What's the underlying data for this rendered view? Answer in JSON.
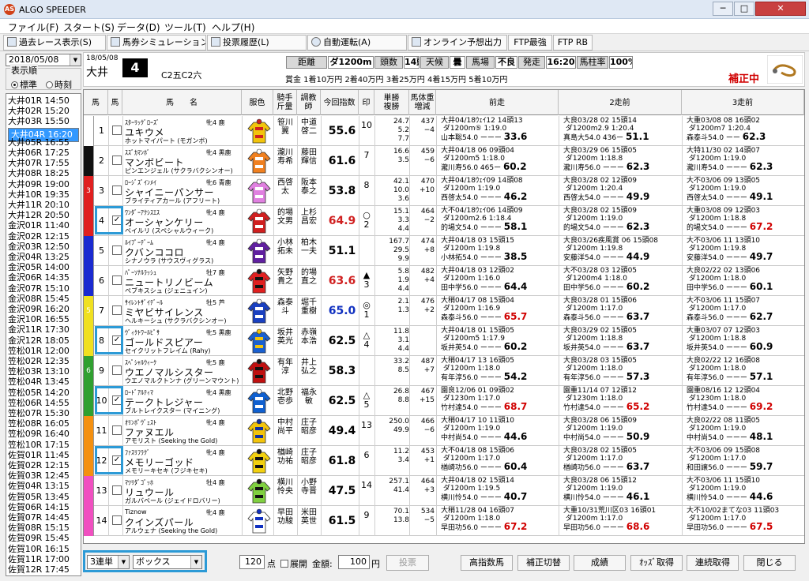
{
  "app": {
    "title": "ALGO SPEEDER",
    "icon": "AS"
  },
  "window": {
    "minimize": "─",
    "maximize": "□",
    "close": "✕"
  },
  "menu": [
    "ファイル(F)",
    "スタート(S)",
    "データ(D)",
    "ツール(T)",
    "ヘルプ(H)"
  ],
  "toolbar": [
    "過去レース表示(S)",
    "馬券シミュレーション(B)",
    "投票履歴(L)",
    "自動運転(A)",
    "オンライン予想出力",
    "FTP最強",
    "FTP RB"
  ],
  "sidebar": {
    "date": "2018/05/08",
    "order_label": "表示順",
    "order_opts": [
      "標準",
      "時刻"
    ],
    "races": [
      "大井01R 14:50",
      "大井02R 15:20",
      "大井03R 15:50",
      "大井04R 16:20",
      "大井05R 16:55",
      "大井06R 17:25",
      "大井07R 17:55",
      "大井08R 18:25",
      "大井09R 19:00",
      "大井10R 19:35",
      "大井11R 20:10",
      "大井12R 20:50",
      "金沢01R 11:40",
      "金沢02R 12:15",
      "金沢03R 12:50",
      "金沢04R 13:25",
      "金沢05R 14:00",
      "金沢06R 14:35",
      "金沢07R 15:10",
      "金沢08R 15:45",
      "金沢09R 16:20",
      "金沢10R 16:55",
      "金沢11R 17:30",
      "金沢12R 18:05",
      "笠松01R 12:00",
      "笠松02R 12:35",
      "笠松03R 13:10",
      "笠松04R 13:45",
      "笠松05R 14:20",
      "笠松06R 14:55",
      "笠松07R 15:30",
      "笠松08R 16:05",
      "笠松09R 16:40",
      "笠松10R 17:15",
      "佐賀01R 11:45",
      "佐賀02R 12:15",
      "佐賀03R 12:45",
      "佐賀04R 13:15",
      "佐賀05R 13:45",
      "佐賀06R 14:15",
      "佐賀07R 14:45",
      "佐賀08R 15:15",
      "佐賀09R 15:45",
      "佐賀10R 16:15",
      "佐賀11R 17:00",
      "佐賀12R 17:45"
    ],
    "selected": 3
  },
  "race": {
    "date": "18/05/08",
    "course": "大井",
    "num": "4",
    "class": "C2五C2六",
    "info": [
      {
        "l": "距離"
      },
      {
        "v": "ダ1200m"
      },
      {
        "l": "頭数"
      },
      {
        "v": "14頭"
      },
      {
        "l": "天候"
      },
      {
        "v": "曇"
      },
      {
        "l": "馬場"
      },
      {
        "v": "不良"
      },
      {
        "l": "発走"
      },
      {
        "v": "16:20"
      },
      {
        "l": "馬柱率"
      },
      {
        "v": "100%"
      }
    ],
    "prizes": "賞金 1着10万円 2着40万円 3着25万円 4着15万円 5着10万円",
    "status": "補正中"
  },
  "headers": [
    "馬",
    "馬",
    "馬　　名",
    "服色",
    "騎手\n斤量",
    "調教\n師",
    "今回指数",
    "印",
    "単勝\n複勝",
    "馬体重\n増減",
    "前走",
    "2走前",
    "3走前"
  ],
  "frame_colors": [
    "#ffffff",
    "#111111",
    "#e02020",
    "#e02020",
    "#1a2ad0",
    "#1a2ad0",
    "#f0e020",
    "#f0e020",
    "#30a030",
    "#30a030",
    "#f49010",
    "#f49010",
    "#f050c0",
    "#f050c0"
  ],
  "frame_labels": [
    "",
    "",
    "3",
    "",
    "",
    "",
    "5",
    "",
    "6",
    "",
    "",
    "",
    "",
    ""
  ],
  "horses": [
    {
      "n": "1",
      "sire": "ｽﾀｰﾘｯｸﾞﾛｰｽﾞ",
      "sex": "牝4 鹿",
      "name": "ユキウメ",
      "dam": "ホットマイパート (モガンボ)",
      "jk": "笹川翼",
      "tr": "中道啓二",
      "idx": "55.6",
      "ic": "#000000",
      "mark": "10",
      "odds": "24.7\n5.2\n7.7",
      "wt": "437\n−4",
      "chk": false,
      "silk": [
        "#f2c40c",
        "#d02020"
      ],
      "p1": "大井04/18ｳｪｲ12 14頭13\n ダ1200m⑤ 1:19.0\n山本聡54.0 ーーー 33.6",
      "p2": "大良03/28 02 15頭14\n ダ1200m2.9 1:20.4\n真島大54.0 436ー 51.1",
      "p3": "大重03/08 08 16頭02\n ダ1200m7 1:20.4\n森泰斗54.0 ーー 62.3"
    },
    {
      "n": "2",
      "sire": "ｽｽﾞｶﾏﾝﾎﾞ",
      "sex": "牝4 黒鹿",
      "name": "マンボビート",
      "dam": "ピンエンジェル (サクラバクシンオー)",
      "jk": "瀧川寿希",
      "tr": "藤田輝信",
      "idx": "61.6",
      "ic": "#000000",
      "mark": "7",
      "odds": "16.6\n3.5",
      "wt": "459\n−6",
      "chk": false,
      "silk": [
        "#f08020",
        "#ffffff"
      ],
      "p1": "大井04/18 06 09頭04\n ダ1200m5 1:18.0\n瀧川寿56.0 465ー 60.2",
      "p2": "大良03/29 06 15頭05\n ダ1200m 1:18.8\n瀧川寿56.0 ーーー 62.3",
      "p3": "大特11/30 02 14頭07\n ダ1200m 1:19.0\n瀧川寿54.0 ーーー 62.3"
    },
    {
      "n": "3",
      "sire": "ﾛｰｼﾞｽﾞｲﾝﾒｲ",
      "sex": "牝6 青鹿",
      "name": "シャイニーパンサー",
      "dam": "ブライティアカール (アフリート)",
      "jk": "西啓太",
      "tr": "阪本泰之",
      "idx": "53.8",
      "ic": "#000000",
      "mark": "8",
      "odds": "42.1\n10.0\n3.6",
      "wt": "470\n+10",
      "chk": false,
      "silk": [
        "#e080e0",
        "#ffffff"
      ],
      "p1": "大井04/18ｳｪｲ09 14頭08\n ダ1200m 1:19.0\n西啓太54.0 ーーー 46.2",
      "p2": "大良03/28 02 12頭09\n ダ1200m 1:20.4\n西啓太54.0 ーーー 49.9",
      "p3": "大不03/06 09 13頭05\n ダ1200m 1:19.0\n西啓太54.0 ーーー 49.1"
    },
    {
      "n": "4",
      "sire": "ﾜﾝﾀﾞｰｱｸｼｽｴｽ",
      "sex": "牝4 鹿",
      "name": "オーシャンケリー",
      "dam": "ベイルリ (スペシャルウィーク)",
      "jk": "的場文男",
      "tr": "上杉昌宏",
      "idx": "64.9",
      "ic": "#d02020",
      "mark": "○\n2",
      "odds": "15.1\n3.3\n4.4",
      "wt": "464\n−2",
      "chk": true,
      "silk": [
        "#d02020",
        "#ffffff"
      ],
      "p1": "大不04/18ｳｪｲ06 14頭09\n ダ1200m2.6 1:18.4\n的場文54.0 ーーー 58.1",
      "p2": "大良03/28 02 15頭09\n ダ1200m 1:19.0\n的場文54.0 ーーー 62.3",
      "p3": "大重03/08 09 12頭03\n ダ1200m 1:18.8\n的場文54.0 ーーー 67.2"
    },
    {
      "n": "5",
      "sire": "ﾙｲﾌﾟｰﾃﾞｰﾑ",
      "sex": "牝4 鹿",
      "name": "クバンココロ",
      "dam": "シナノウラ (サウスヴィグラス)",
      "jk": "小林拓未",
      "tr": "柏木一夫",
      "idx": "51.1",
      "ic": "#000000",
      "mark": "",
      "odds": "167.7\n29.5\n9.9",
      "wt": "474\n+8",
      "chk": false,
      "silk": [
        "#6020a0",
        "#ffffff"
      ],
      "p1": "大井04/18 03 15頭15\n ダ1200m 1:19.8\n小林拓54.0 ーーー 38.5",
      "p2": "大良03/26疾風賞 06 15頭08\n ダ1200m 1:19.8\n安藤洋54.0 ーーー 44.9",
      "p3": "大不03/06 11 13頭10\n ダ1200m 1:19.8\n安藤洋54.0 ーーー 49.7"
    },
    {
      "n": "6",
      "sire": "ﾊﾟｰｿﾅﾙﾗｯｼｭ",
      "sex": "牡7 鹿",
      "name": "ニュートリノビーム",
      "dam": "ペブキスシュ (ジェニュイン)",
      "jk": "矢野貴之",
      "tr": "的場直之",
      "idx": "63.6",
      "ic": "#d02020",
      "mark": "▲\n3",
      "odds": "5.8\n1.9\n4.4",
      "wt": "482\n+4",
      "chk": false,
      "silk": [
        "#e02020",
        "#111111"
      ],
      "p1": "大井04/18 03 12頭02\n ダ1200m 1:16.0\n田中学56.0 ーーー 64.4",
      "p2": "大不03/28 03 12頭05\n ダ1200m4 1:18.0\n田中学56.0 ーーー 60.2",
      "p3": "大良02/22 02 13頭06\n ダ1200m 1:18.0\n田中学56.0 ーーー 60.1"
    },
    {
      "n": "7",
      "sire": "ｻｲﾚﾝﾄｻﾞｲﾃﾞｰﾙ",
      "sex": "牡5 芦",
      "name": "ミヤビサイレンス",
      "dam": "ヘルキーシュ (サクラバクシンオー)",
      "jk": "森泰斗",
      "tr": "堀千重樹",
      "idx": "65.0",
      "ic": "#1030c0",
      "mark": "◎\n1",
      "odds": "2.1\n1.3",
      "wt": "476\n+2",
      "chk": false,
      "silk": [
        "#1a40c0",
        "#ffffff"
      ],
      "p1": "大稍04/17 08 15頭04\n ダ1200m 1:16.9\n森泰斗56.0 ーーー 65.7",
      "p2": "大良03/28 01 15頭06\n ダ1200m 1:17.0\n森泰斗56.0 ーーー 63.7",
      "p3": "大不03/06 11 15頭07\n ダ1200m 1:17.0\n森泰斗56.0 ーーー 62.7"
    },
    {
      "n": "8",
      "sire": "ｳﾞｨｸﾄﾜｰﾙﾋﾟｻ",
      "sex": "牝5 黒鹿",
      "name": "ゴールドスピアー",
      "dam": "セイクリットフレイム (Rahy)",
      "jk": "坂井英光",
      "tr": "赤嶺本浩",
      "idx": "62.5",
      "ic": "#000000",
      "mark": "△\n4",
      "odds": "11.8\n3.1\n4.4",
      "wt": "",
      "chk": true,
      "silk": [
        "#1a60d0",
        "#f2c40c"
      ],
      "p1": "大井04/18 01 15頭05\n ダ1200m5 1:17.9\n坂井英54.0 ーーー 60.2",
      "p2": "大良03/29 02 15頭05\n ダ1200m 1:18.8\n坂井英54.0 ーーー 63.7",
      "p3": "大重03/07 07 12頭03\n ダ1200m 1:18.8\n坂井英54.0 ーーー 60.9"
    },
    {
      "n": "9",
      "sire": "ｽﾍﾟｼｬﾙｳｨｰｸ",
      "sex": "牝5 鹿",
      "name": "ウエノマルシスター",
      "dam": "ウエノマルクトンナ (グリーンマウント)",
      "jk": "有年淳",
      "tr": "井上弘之",
      "idx": "58.3",
      "ic": "#000000",
      "mark": "",
      "odds": "33.2\n8.5",
      "wt": "487\n+7",
      "chk": false,
      "silk": [
        "#c01010",
        "#111111"
      ],
      "p1": "大稍04/17 13 16頭05\n ダ1200m 1:18.0\n有年淳56.0 ーーー 54.2",
      "p2": "大良03/28 03 15頭05\n ダ1200m 1:18.0\n有年淳56.0 ーーー 57.3",
      "p3": "大良02/22 12 16頭08\n ダ1200m 1:18.0\n有年淳56.0 ーーー 57.1"
    },
    {
      "n": "10",
      "sire": "ﾛｰﾄﾞｱﾙﾃｨﾏ",
      "sex": "牝4 黒鹿",
      "name": "テークトレジャー",
      "dam": "ブルトレイクスター (マイニング)",
      "jk": "北野壱歩",
      "tr": "福永敏",
      "idx": "62.5",
      "ic": "#000000",
      "mark": "△\n5",
      "odds": "26.8\n8.8",
      "wt": "467\n+15",
      "chk": true,
      "silk": [
        "#1060d0",
        "#ffffff"
      ],
      "p1": "園良12/06 01 09頭02\n ダ1230m 1:17.0\n竹村達54.0 ーーー 68.7",
      "p2": "園重11/14 07 12頭12\n ダ1230m 1:18.0\n竹村達54.0 ーーー 65.2",
      "p3": "園重08/16 12 12頭04\n ダ1230m 1:18.0\n竹村達54.0 ーーー 69.2"
    },
    {
      "n": "11",
      "sire": "ｵﾘﾝﾎﾟｳﾞｪｽﾄ",
      "sex": "牝4 鹿",
      "name": "ファヌエル",
      "dam": "アモリスト (Seeking the Gold)",
      "jk": "中村尚平",
      "tr": "庄子昭彦",
      "idx": "49.4",
      "ic": "#000000",
      "mark": "13",
      "odds": "250.0\n49.9\n ",
      "wt": "466\n−6",
      "chk": false,
      "silk": [
        "#f2c40c",
        "#1030a0"
      ],
      "p1": "大稍04/17 10 11頭10\n ダ1200m 1:19.0\n中村尚54.0 ーーー 44.6",
      "p2": "大良03/28 06 15頭09\n ダ1200m 1:19.0\n中村尚54.0 ーーー 50.9",
      "p3": "大良02/22 08 11頭05\n ダ1200m 1:19.0\n中村尚54.0 ーーー 48.1"
    },
    {
      "n": "12",
      "sire": "ﾌｧｽﾘﾌﾗｸﾞ",
      "sex": "牝4 鹿",
      "name": "メモリーゴッド",
      "dam": "メモリーキセキ (フジキセキ)",
      "jk": "楢崎功祐",
      "tr": "庄子昭彦",
      "idx": "61.8",
      "ic": "#000000",
      "mark": "6",
      "odds": "11.2\n3.4",
      "wt": "453\n+1",
      "chk": true,
      "silk": [
        "#f2d010",
        "#111111"
      ],
      "p1": "大不04/18 08 15頭06\n ダ1200m 1:17.0\n楢崎功56.0 ーーー 60.4",
      "p2": "大良03/28 02 15頭05\n ダ1200m 1:17.0\n楢崎功56.0 ーーー 63.7",
      "p3": "大不03/06 09 15頭08\n ダ1200m 1:17.0\n和田譲56.0 ーーー 59.7"
    },
    {
      "n": "13",
      "sire": "ﾏﾂﾘﾀﾞｺﾞｯﾎ",
      "sex": "牡4 鹿",
      "name": "リュウール",
      "dam": "ガルバベール (ジェイドロバリー)",
      "jk": "横川怜央",
      "tr": "小野寺晋",
      "idx": "47.5",
      "ic": "#000000",
      "mark": "14",
      "odds": "257.1\n41.4\n ",
      "wt": "464\n+3",
      "chk": false,
      "silk": [
        "#80d040",
        "#111111"
      ],
      "p1": "大井04/18 02 15頭14\n ダ1200m 1:19.5\n横川怜54.0 ーーー 40.7",
      "p2": "大良03/28 06 15頭12\n ダ1200m 1:19.0\n横川怜54.0 ーーー 46.1",
      "p3": "大不03/06 11 15頭10\n ダ1200m 1:19.0\n横川怜54.0 ーーー 44.6"
    },
    {
      "n": "14",
      "sire": "Tiznow",
      "sex": "牝4 鹿",
      "name": "クインズパール",
      "dam": "アルウェナ (Seeking the Gold)",
      "jk": "早田功駿",
      "tr": "米田英世",
      "idx": "61.5",
      "ic": "#000000",
      "mark": "9",
      "odds": "70.1\n13.8",
      "wt": "534\n−5",
      "chk": false,
      "silk": [
        "#ffffff",
        "#1030c0"
      ],
      "p1": "大稍11/28 04 16頭07\n ダ1200m 1:18.0\n早田功56.0 ーーー 67.2",
      "p2": "大重10/31荒川区03 16頭01\n ダ1200m 1:17.0\n早田功56.0 ーーー 68.6",
      "p3": "大不10/02まてな03 11頭03\n ダ1200m 1:17.0\n早田功56.0 ーーー 67.5"
    }
  ],
  "bottom": {
    "bet_type": "3連単",
    "bet_method": "ボックス",
    "points": "120",
    "points_unit": "点",
    "expand": "展開",
    "amount_label": "金額:",
    "amount": "100",
    "amount_unit": "円",
    "vote": "投票",
    "buttons": [
      "高指数馬",
      "補正切替",
      "成績",
      "ｵｯｽﾞ取得",
      "連続取得",
      "閉じる"
    ]
  }
}
